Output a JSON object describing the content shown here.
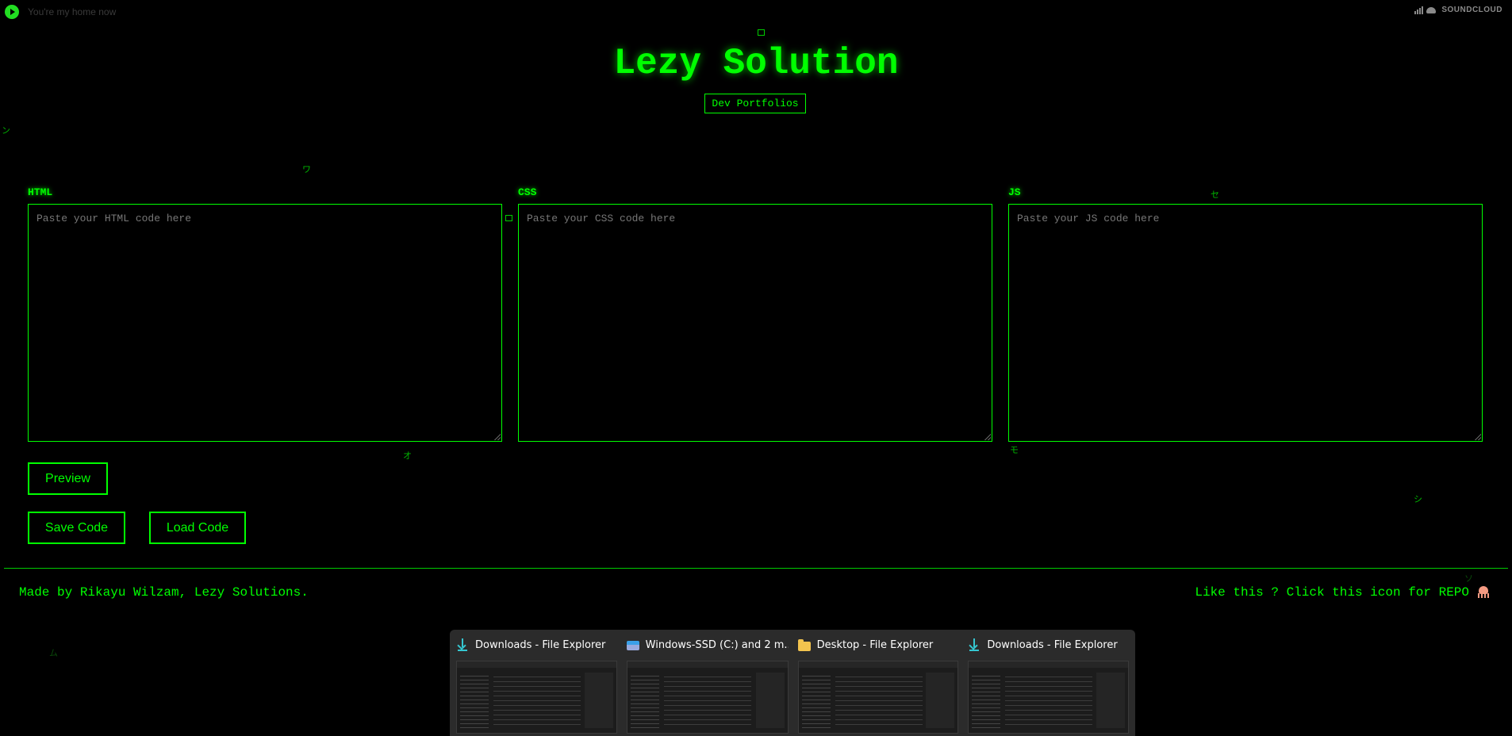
{
  "player": {
    "track": "You're my home now",
    "brand": "SOUNDCLOUD"
  },
  "header": {
    "title": "Lezy Solution",
    "portfolio_link": "Dev Portfolios"
  },
  "editors": [
    {
      "label": "HTML",
      "placeholder": "Paste your HTML code here"
    },
    {
      "label": "CSS",
      "placeholder": "Paste your CSS code here"
    },
    {
      "label": "JS",
      "placeholder": "Paste your JS code here"
    }
  ],
  "actions": {
    "preview": "Preview",
    "save": "Save Code",
    "load": "Load Code"
  },
  "footer": {
    "credit": "Made by Rikayu Wilzam, Lezy Solutions.",
    "repo_prompt": "Like this ? Click this icon for REPO"
  },
  "rain_glyphs": [
    "ン",
    "ワ",
    "セ",
    "オ",
    "モ",
    "シ",
    "ソ",
    "ム"
  ],
  "taskbar": {
    "items": [
      {
        "title": "Downloads - File Explorer",
        "icon": "download-icon"
      },
      {
        "title": "Windows-SSD (C:) and 2 m...",
        "icon": "drive-icon"
      },
      {
        "title": "Desktop - File Explorer",
        "icon": "folder-icon"
      },
      {
        "title": "Downloads - File Explorer",
        "icon": "download-icon"
      }
    ]
  },
  "colors": {
    "accent": "#00ff00",
    "background": "#000000",
    "placeholder": "#777777"
  }
}
